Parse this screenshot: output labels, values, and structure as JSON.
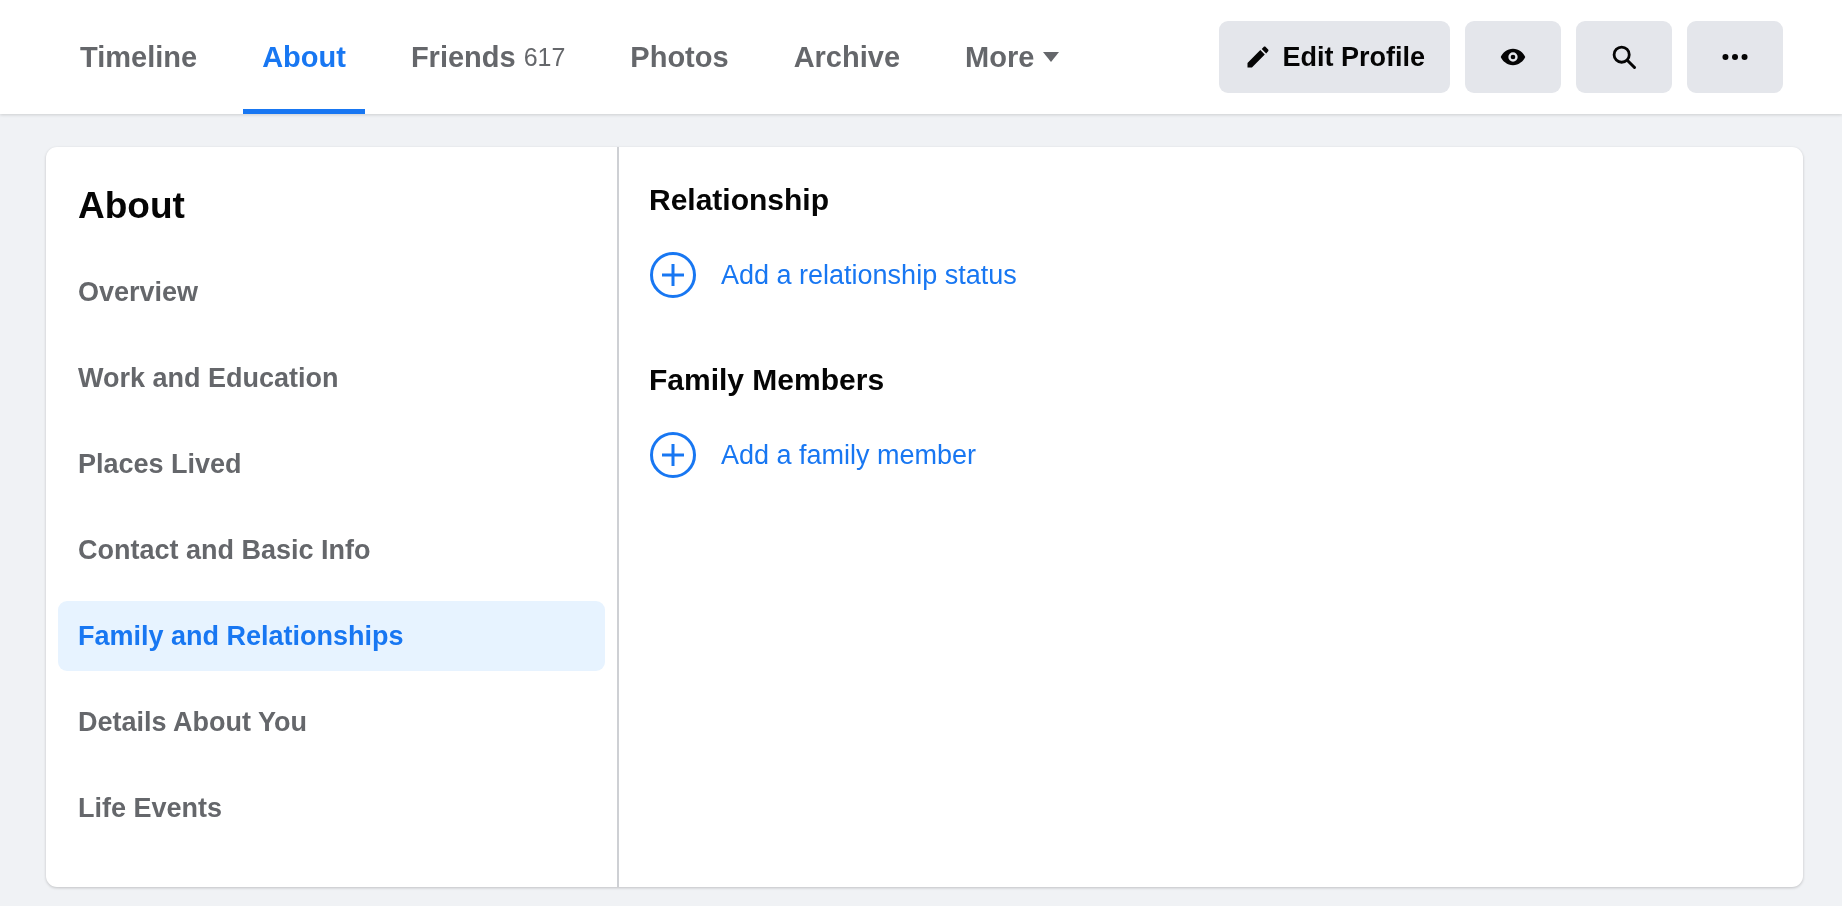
{
  "tabs": [
    {
      "label": "Timeline",
      "selected": false
    },
    {
      "label": "About",
      "selected": true
    },
    {
      "label": "Friends",
      "count": "617",
      "selected": false
    },
    {
      "label": "Photos",
      "selected": false
    },
    {
      "label": "Archive",
      "selected": false
    },
    {
      "label": "More",
      "kind": "dropdown",
      "selected": false
    }
  ],
  "actions": [
    {
      "kind": "edit",
      "label": "Edit Profile"
    },
    {
      "kind": "view"
    },
    {
      "kind": "search"
    },
    {
      "kind": "more"
    }
  ],
  "sidebar": {
    "title": "About",
    "items": [
      {
        "label": "Overview",
        "selected": false
      },
      {
        "label": "Work and Education",
        "selected": false
      },
      {
        "label": "Places Lived",
        "selected": false
      },
      {
        "label": "Contact and Basic Info",
        "selected": false
      },
      {
        "label": "Family and Relationships",
        "selected": true
      },
      {
        "label": "Details About You",
        "selected": false
      },
      {
        "label": "Life Events",
        "selected": false
      }
    ]
  },
  "sections": [
    {
      "title": "Relationship",
      "action": "Add a relationship status"
    },
    {
      "title": "Family Members",
      "action": "Add a family member"
    }
  ]
}
